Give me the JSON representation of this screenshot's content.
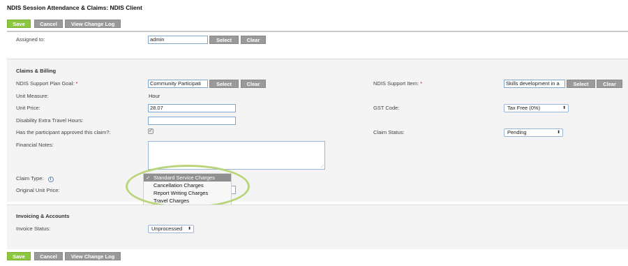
{
  "page": {
    "title": "NDIS Session Attendance & Claims: NDIS Client"
  },
  "toolbar": {
    "save": "Save",
    "cancel": "Cancel",
    "change_log": "View Change Log"
  },
  "assigned": {
    "label": "Assigned to:",
    "value": "admin",
    "select": "Select",
    "clear": "Clear"
  },
  "claims": {
    "heading": "Claims & Billing",
    "goal": {
      "label": "NDIS Support Plan Goal:",
      "req": "*",
      "value": "Community Participati",
      "select": "Select",
      "clear": "Clear"
    },
    "support_item": {
      "label": "NDIS Support Item:",
      "req": "*",
      "value": "Skills development in a",
      "select": "Select",
      "clear": "Clear"
    },
    "unit_measure": {
      "label": "Unit Measure:",
      "value": "Hour"
    },
    "unit_price": {
      "label": "Unit Price:",
      "value": "28.07"
    },
    "gst": {
      "label": "GST Code:",
      "value": "Tax Free (0%)",
      "caret": "⬍"
    },
    "travel_hours": {
      "label": "Disability Extra Travel Hours:",
      "value": ""
    },
    "approved": {
      "label": "Has the participant approved this claim?:",
      "mark": "✓"
    },
    "claim_status": {
      "label": "Claim Status:",
      "value": "Pending",
      "caret": "⬍"
    },
    "financial_notes": {
      "label": "Financial Notes:",
      "resize": "⟋"
    },
    "claim_type": {
      "label": "Claim Type:",
      "info": "i",
      "check": "✓",
      "options": [
        "Standard Service Charges",
        "Cancellation Charges",
        "Report Writing Charges",
        "Travel Charges"
      ]
    },
    "original_unit_price": {
      "label": "Original Unit Price:"
    }
  },
  "invoicing": {
    "heading": "Invoicing & Accounts",
    "status": {
      "label": "Invoice Status:",
      "value": "Unprocessed",
      "caret": "⬍"
    }
  },
  "colors": {
    "primary_button": "#8dc63f",
    "secondary_button": "#9a9a9a",
    "highlight": "#b9d57a",
    "required": "#d0021b"
  }
}
